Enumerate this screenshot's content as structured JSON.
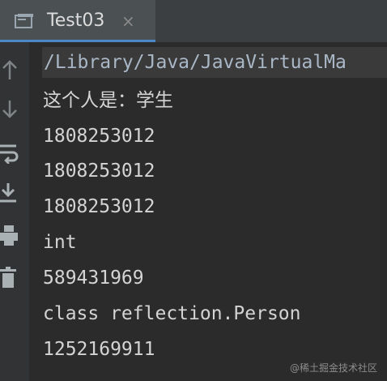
{
  "tab": {
    "title": "Test03",
    "close_glyph": "×",
    "icon": "console-window-icon"
  },
  "gutter": {
    "icons": [
      "up-arrow-icon",
      "down-arrow-icon",
      "soft-wrap-icon",
      "scroll-to-end-icon",
      "print-icon",
      "delete-icon"
    ]
  },
  "console": {
    "command_line": "/Library/Java/JavaVirtualMa",
    "lines": [
      "这个人是：学生",
      "1808253012",
      "1808253012",
      "1808253012",
      "int",
      "589431969",
      "class reflection.Person",
      "1252169911"
    ]
  },
  "watermark": "@稀土掘金技术社区",
  "colors": {
    "background": "#2b2b2b",
    "tab_accent": "#4a88c7",
    "text": "#d4d4d4"
  }
}
